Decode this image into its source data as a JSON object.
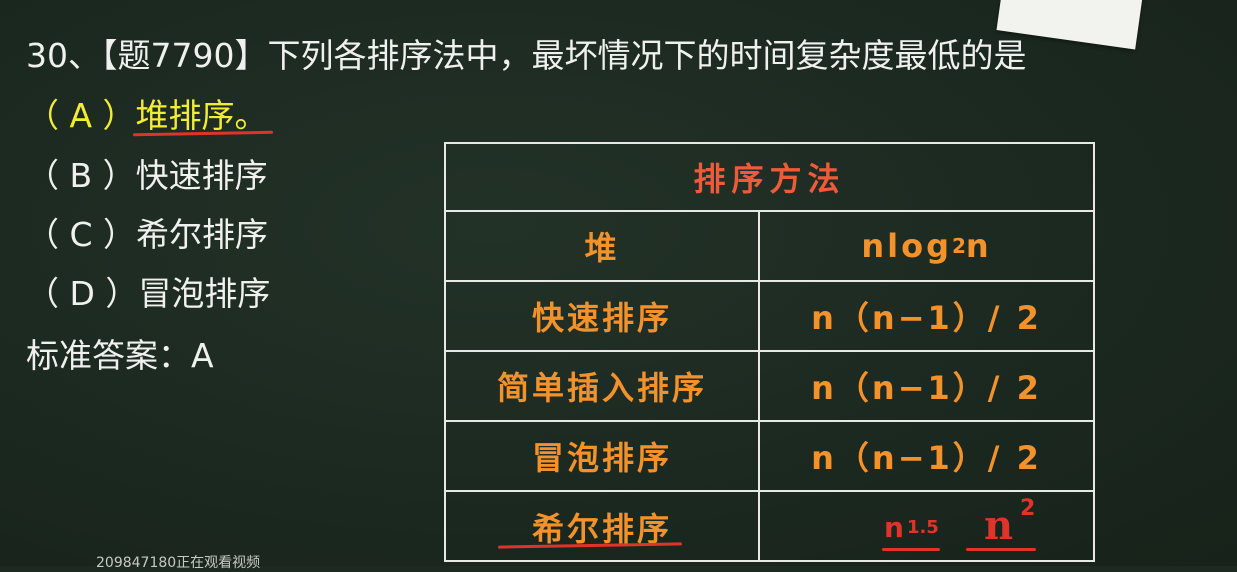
{
  "question": {
    "title": "30、【题7790】下列各排序法中，最坏情况下的时间复杂度最低的是",
    "options": [
      "（ A ）堆排序。",
      "（ B ）快速排序",
      "（ C ）希尔排序",
      "（ D ）冒泡排序"
    ],
    "answer": "标准答案：A"
  },
  "table": {
    "header": "排序方法",
    "rows": [
      {
        "method": "堆",
        "complexity": "nlog",
        "sub": "2",
        "tail": "n"
      },
      {
        "method": "快速排序",
        "complexity": "n（n−1）/ 2"
      },
      {
        "method": "简单插入排序",
        "complexity": "n（n−1）/ 2"
      },
      {
        "method": "冒泡排序",
        "complexity": "n（n−1）/ 2"
      },
      {
        "method": "希尔排序",
        "complexity": "n",
        "sup": "1.5"
      }
    ],
    "annotation": {
      "base": "n",
      "exp": "2"
    }
  },
  "footer": "209847180正在观看视频",
  "colors": {
    "board": "#1b2820",
    "chalk_white": "#f0f0ee",
    "highlight_yellow": "#f2ec35",
    "table_orange": "#f3922b",
    "header_red": "#ef5a3a",
    "marker_red": "#e0342a"
  }
}
